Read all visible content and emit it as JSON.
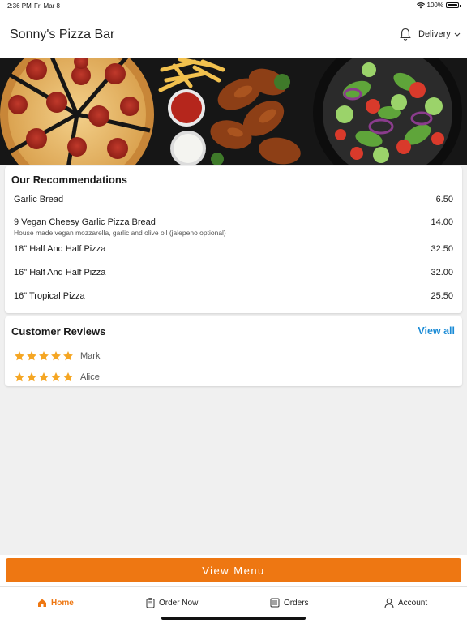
{
  "status_bar": {
    "time": "2:36 PM",
    "date": "Fri Mar 8",
    "battery": "100%"
  },
  "header": {
    "title": "Sonny's Pizza Bar",
    "mode": "Delivery"
  },
  "recommendations": {
    "title": "Our Recommendations",
    "items": [
      {
        "name": "Garlic Bread",
        "description": "",
        "price": "6.50"
      },
      {
        "name": "9 Vegan Cheesy Garlic Pizza Bread",
        "description": "House made vegan mozzarella, garlic and olive oil (jalepeno optional)",
        "price": "14.00"
      },
      {
        "name": "18\" Half And Half Pizza",
        "description": "",
        "price": "32.50"
      },
      {
        "name": "16\" Half And Half Pizza",
        "description": "",
        "price": "32.00"
      },
      {
        "name": "16\" Tropical Pizza",
        "description": "",
        "price": "25.50"
      }
    ]
  },
  "reviews": {
    "title": "Customer Reviews",
    "view_all": "View all",
    "items": [
      {
        "name": "Mark",
        "rating": 5
      },
      {
        "name": "Alice",
        "rating": 5
      }
    ]
  },
  "cta": {
    "view_menu": "View Menu"
  },
  "bottom_nav": {
    "items": [
      {
        "label": "Home",
        "icon": "home-icon",
        "active": true
      },
      {
        "label": "Order Now",
        "icon": "order-icon",
        "active": false
      },
      {
        "label": "Orders",
        "icon": "orders-list-icon",
        "active": false
      },
      {
        "label": "Account",
        "icon": "account-icon",
        "active": false
      }
    ]
  },
  "colors": {
    "accent": "#ee7712",
    "link": "#1a8bd6",
    "star": "#f5a623",
    "background": "#f0f0f0"
  }
}
